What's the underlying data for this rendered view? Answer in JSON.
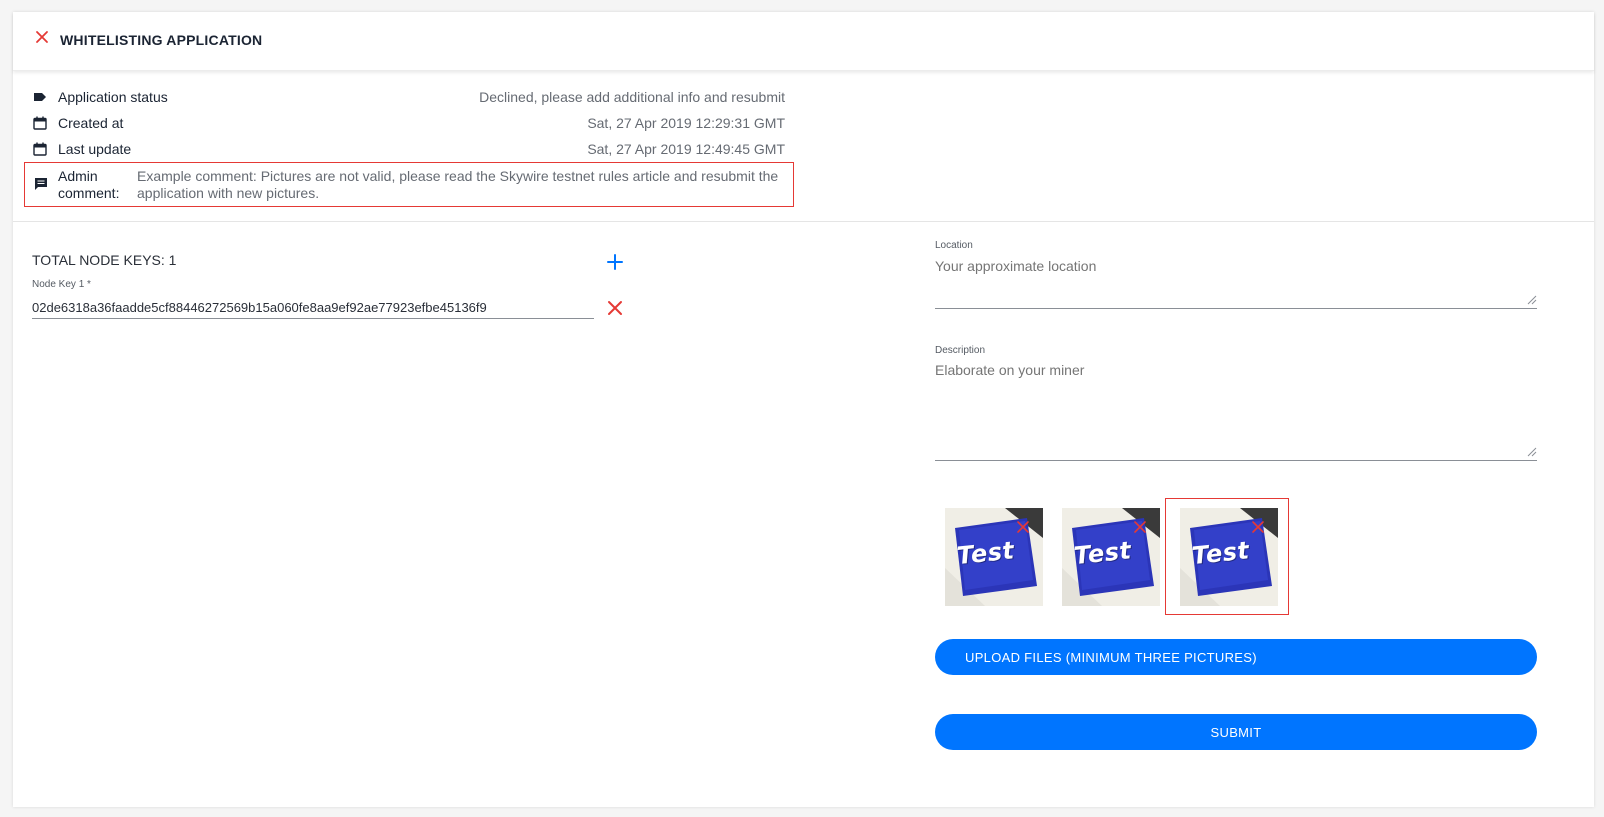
{
  "header": {
    "title": "WHITELISTING APPLICATION",
    "close_icon": "close-icon"
  },
  "info": {
    "status_label": "Application status",
    "status_value": "Declined, please add additional info and resubmit",
    "created_label": "Created at",
    "created_value": "Sat, 27 Apr 2019 12:29:31 GMT",
    "updated_label": "Last update",
    "updated_value": "Sat, 27 Apr 2019 12:49:45 GMT",
    "comment_label": "Admin comment:",
    "comment_value": "Example comment: Pictures are not valid, please read the Skywire testnet rules article and resubmit the application with new pictures."
  },
  "node_keys": {
    "total_label": "TOTAL NODE KEYS: 1",
    "keys": [
      {
        "label": "Node Key 1 *",
        "value": "02de6318a36faadde5cf88446272569b15a060fe8aa9ef92ae77923efbe45136f9"
      }
    ]
  },
  "form": {
    "location_label": "Location",
    "location_placeholder": "Your approximate location",
    "description_label": "Description",
    "description_placeholder": "Elaborate on your miner"
  },
  "images": [
    {
      "caption": "Test"
    },
    {
      "caption": "Test"
    },
    {
      "caption": "Test"
    }
  ],
  "buttons": {
    "upload_label": "UPLOAD FILES (MINIMUM THREE PICTURES)",
    "submit_label": "SUBMIT"
  },
  "colors": {
    "accent": "#0075ff",
    "danger": "#e53935",
    "title": "#1b2433"
  }
}
